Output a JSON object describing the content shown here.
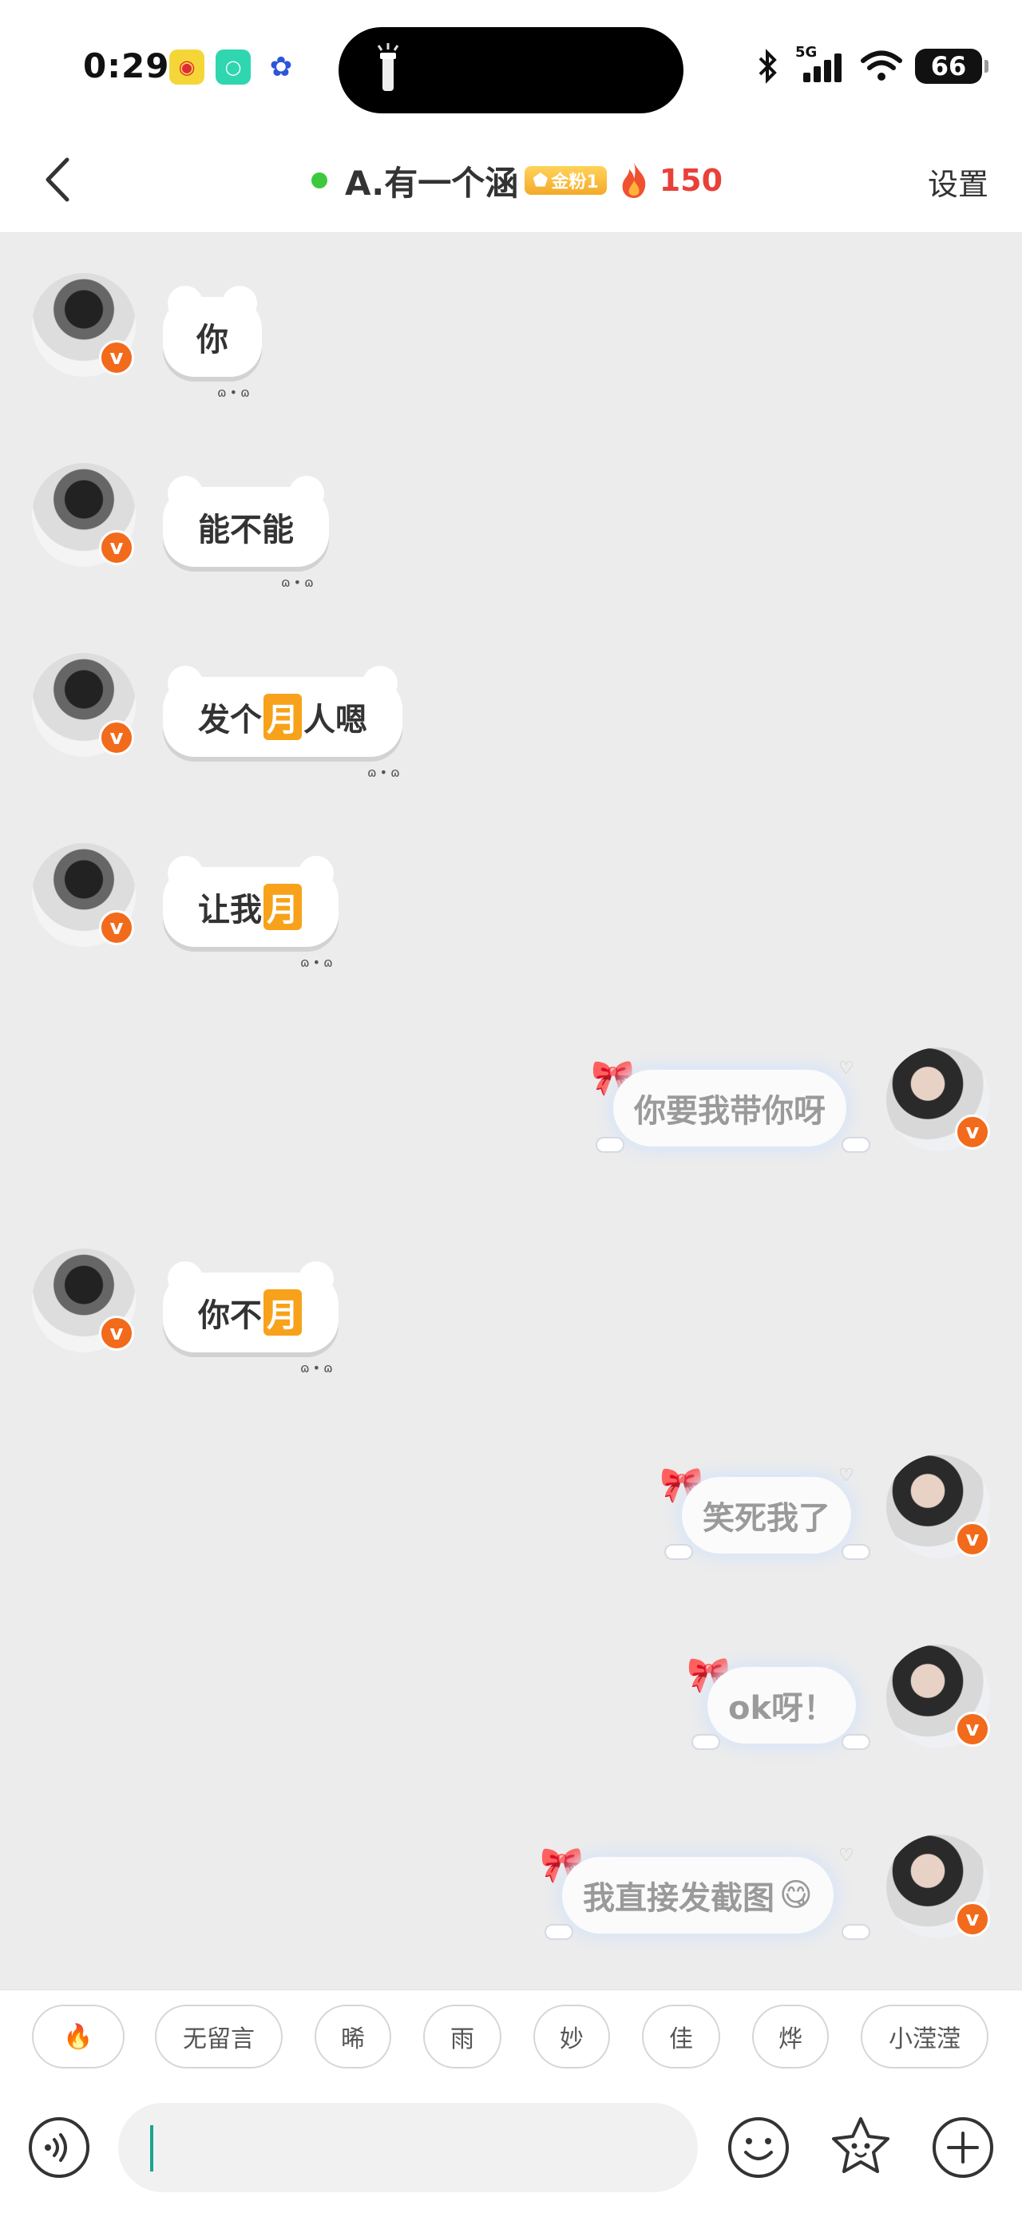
{
  "status_bar": {
    "time": "0:29",
    "battery": "66",
    "network": "5G"
  },
  "header": {
    "title": "A.有一个涵",
    "fan_badge": "金粉1",
    "fire_count": "150",
    "settings": "设置"
  },
  "messages": [
    {
      "side": "left",
      "text": "你"
    },
    {
      "side": "left",
      "text": "能不能"
    },
    {
      "side": "left",
      "text_before": "发个",
      "emoji": "月",
      "text_after": "人嗯"
    },
    {
      "side": "left",
      "text_before": "让我",
      "emoji": "月"
    },
    {
      "side": "right",
      "text": "你要我带你呀"
    },
    {
      "side": "left",
      "text_before": "你不",
      "emoji": "月"
    },
    {
      "side": "right",
      "text": "笑死我了"
    },
    {
      "side": "right",
      "text": "ok呀！"
    },
    {
      "side": "right",
      "text": "我直接发截图",
      "emoji": "😋"
    }
  ],
  "quick_replies": [
    "🔥",
    "无留言",
    "晞",
    "雨",
    "妙",
    "佳",
    "烨",
    "小滢滢"
  ],
  "input": {
    "placeholder": ""
  },
  "colors": {
    "accent": "#f26a1b",
    "online": "#3dc93d",
    "fire": "#e8413a",
    "chat_bg": "#ececec"
  },
  "icons": [
    "back-icon",
    "flashlight-icon",
    "bluetooth-icon",
    "signal-icon",
    "wifi-icon",
    "fire-icon",
    "voice-icon",
    "emoji-icon",
    "sticker-star-icon",
    "plus-icon"
  ]
}
